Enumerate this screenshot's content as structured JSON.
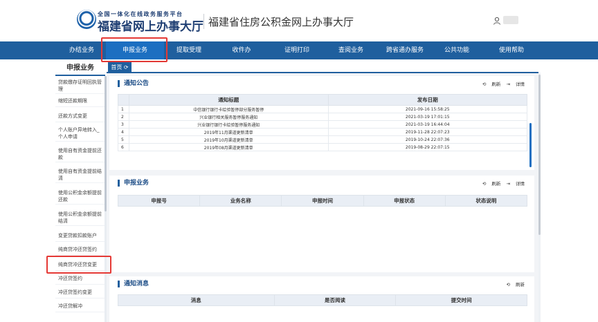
{
  "header": {
    "logo_top_line": "全国一体化在线政务服务平台",
    "logo_main": "福建省网上办事大厅",
    "site_title": "福建省住房公积金网上办事大厅"
  },
  "nav": {
    "items": [
      {
        "label": "办结业务",
        "active": false
      },
      {
        "label": "申报业务",
        "active": true
      },
      {
        "label": "提取受理",
        "active": false
      },
      {
        "label": "收件办",
        "active": false
      },
      {
        "label": "证明打印",
        "active": false
      },
      {
        "label": "查阅业务",
        "active": false
      },
      {
        "label": "跨省通办服务",
        "active": false
      },
      {
        "label": "公共功能",
        "active": false
      },
      {
        "label": "使用帮助",
        "active": false
      }
    ]
  },
  "sidebar": {
    "title": "申报业务",
    "items": [
      {
        "label": "贷款缴存证明回执管理"
      },
      {
        "label": "缩短还款期限"
      },
      {
        "label": "还款方式变更"
      },
      {
        "label": "个人账户异地转入_个人申请"
      },
      {
        "label": "使用自有资金提前还款"
      },
      {
        "label": "使用自有资金提前结清"
      },
      {
        "label": "使用公积金余额提前还款"
      },
      {
        "label": "使用公积金余额提前结清"
      },
      {
        "label": "变更贷款扣款账户"
      },
      {
        "label": "纯商贷冲还贷签约"
      },
      {
        "label": "纯商贷冲还贷变更"
      },
      {
        "label": "冲还贷签约"
      },
      {
        "label": "冲还贷签约变更"
      },
      {
        "label": "冲还贷解冲"
      }
    ]
  },
  "tabs": {
    "home_label": "首页 ⟳"
  },
  "notice_panel": {
    "title": "通知公告",
    "refresh_label": "刷新",
    "detail_label": "详情",
    "columns": [
      "通知标题",
      "发布日期"
    ],
    "rows": [
      {
        "idx": "1",
        "title": "中信银行银行卡绘验暂停部分服务暂停",
        "date": "2021-09-16 15:58:25"
      },
      {
        "idx": "2",
        "title": "兴业银行相关服务暂停服务通知",
        "date": "2021-03-19 17:01:15"
      },
      {
        "idx": "3",
        "title": "兴业银行银行卡绘验暂停服务通知",
        "date": "2021-03-19 16:44:04"
      },
      {
        "idx": "4",
        "title": "2019年11月渠道更新清单",
        "date": "2019-11-28 22:07:23"
      },
      {
        "idx": "5",
        "title": "2019年10月渠道更新清单",
        "date": "2019-10-24 22:07:36"
      },
      {
        "idx": "6",
        "title": "2019年08月渠道更新清单",
        "date": "2019-08-29 22:07:15"
      }
    ]
  },
  "business_panel": {
    "title": "申报业务",
    "refresh_label": "刷新",
    "detail_label": "详情",
    "columns": [
      "申报号",
      "业务名称",
      "申报时间",
      "申报状态",
      "状态说明"
    ]
  },
  "message_panel": {
    "title": "通知消息",
    "refresh_label": "刷新",
    "columns": [
      "消息",
      "是否阅读",
      "提交时间"
    ]
  },
  "colors": {
    "nav_bg": "#1f5f9e",
    "nav_active": "#1c6fc1",
    "highlight": "#e53935"
  }
}
